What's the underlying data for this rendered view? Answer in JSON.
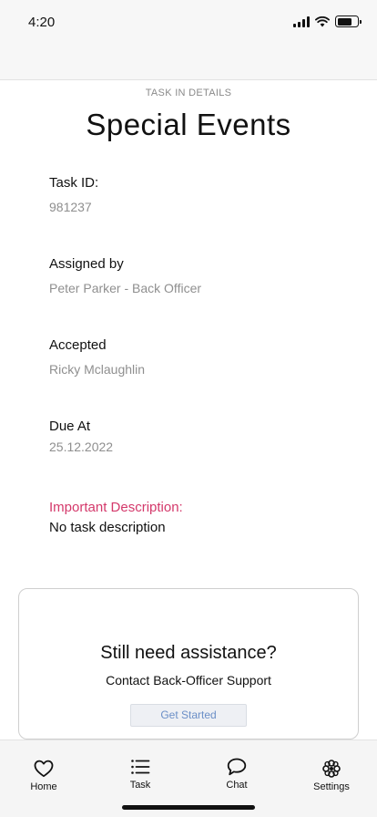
{
  "status_bar": {
    "time": "4:20",
    "icons": [
      "cellular-signal-icon",
      "wifi-icon",
      "battery-icon"
    ]
  },
  "header": {
    "eyebrow": "TASK IN DETAILS",
    "title": "Special Events"
  },
  "details": {
    "task_id": {
      "label": "Task ID:",
      "value": "981237"
    },
    "assigned_by": {
      "label": "Assigned by",
      "value": "Peter Parker - Back Officer"
    },
    "accepted": {
      "label": "Accepted",
      "value": "Ricky Mclaughlin"
    },
    "due_at": {
      "label": "Due At",
      "value": "25.12.2022"
    },
    "description": {
      "label": "Important Description:",
      "value": "No task description"
    }
  },
  "support": {
    "title": "Still need assistance?",
    "subtitle": "Contact Back-Officer Support",
    "button_label": "Get Started"
  },
  "tabs": [
    {
      "label": "Home",
      "icon": "heart-icon"
    },
    {
      "label": "Task",
      "icon": "list-icon"
    },
    {
      "label": "Chat",
      "icon": "chat-bubble-icon"
    },
    {
      "label": "Settings",
      "icon": "flower-icon"
    }
  ],
  "colors": {
    "important": "#d4396b",
    "button_text": "#6b8fc7",
    "muted_text": "#8f8f8f"
  }
}
